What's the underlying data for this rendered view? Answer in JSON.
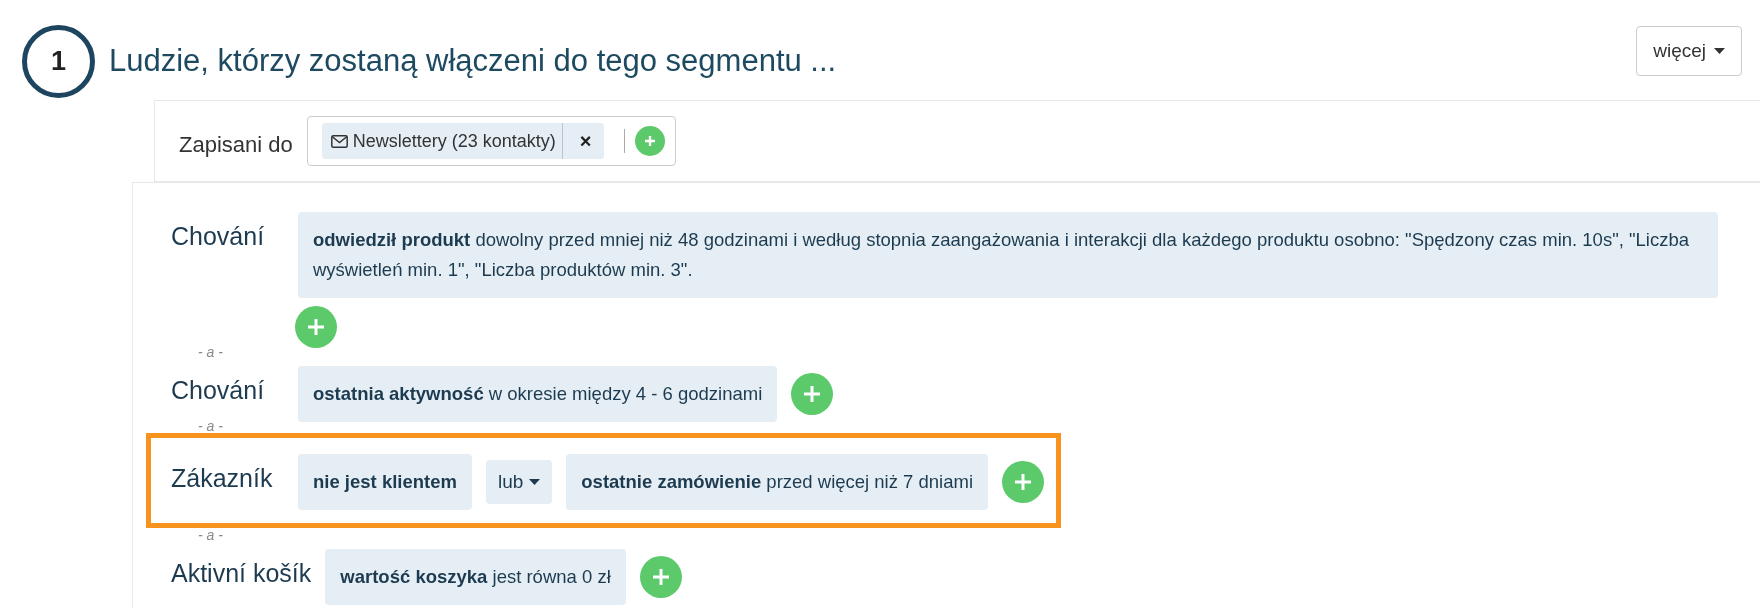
{
  "step": {
    "number": "1",
    "title": "Ludzie, którzy zostaną włączeni do tego segmentu ..."
  },
  "more_button": {
    "label": "więcej"
  },
  "subscribed": {
    "label": "Zapisani do",
    "tags": [
      {
        "text": "Newslettery (23 kontakty)",
        "remove": "×"
      }
    ]
  },
  "groups": [
    {
      "label": "Chování",
      "highlighted": false,
      "conditions": [
        {
          "kind": "condition",
          "text": "**odwiedził produkt** dowolny przed mniej niż 48 godzinami i według stopnia zaangażowania i interakcji dla każdego produktu osobno: \"Spędzony czas min. 10s\", \"Liczba wyświetleń min. 1\", \"Liczba produktów min. 3\"."
        }
      ]
    },
    {
      "connector": "- a -",
      "label": "Chování",
      "highlighted": false,
      "conditions": [
        {
          "kind": "condition",
          "text": "**ostatnia aktywność** w okresie między 4 - 6 godzinami"
        }
      ]
    },
    {
      "connector": "- a -",
      "label": "Zákazník",
      "highlighted": true,
      "conditions": [
        {
          "kind": "condition",
          "text": "**nie jest klientem**"
        },
        {
          "kind": "operator",
          "text": "lub"
        },
        {
          "kind": "condition",
          "text": "**ostatnie zamówienie** przed więcej niż 7 dniami"
        }
      ]
    },
    {
      "connector": "- a -",
      "label": "Aktivní košík",
      "highlighted": false,
      "conditions": [
        {
          "kind": "condition",
          "text": "**wartość koszyka** jest równa 0 zł"
        }
      ]
    }
  ]
}
